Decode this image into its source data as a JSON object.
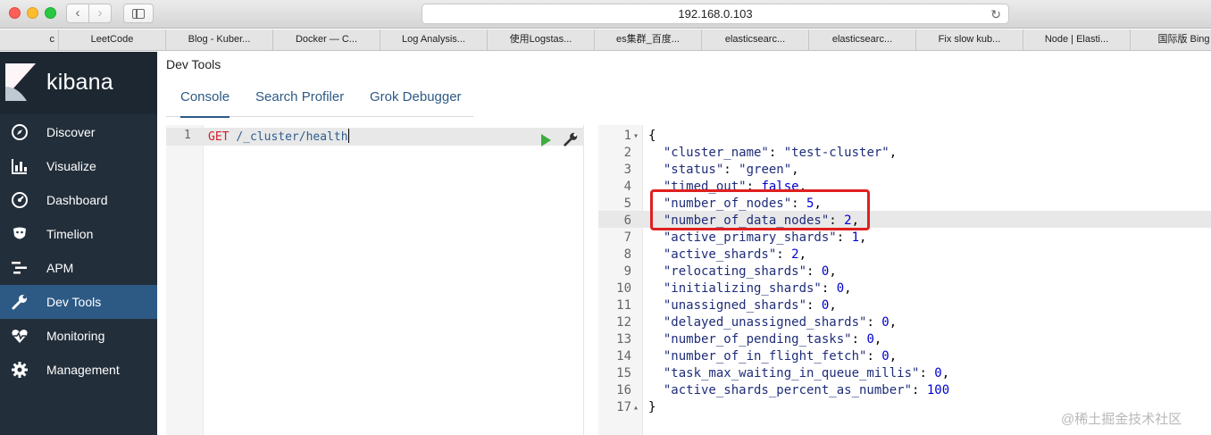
{
  "browser": {
    "url": "192.168.0.103",
    "bookmarks": [
      "c",
      "LeetCode",
      "Blog - Kuber...",
      "Docker — C...",
      "Log Analysis...",
      "使用Logstas...",
      "es集群_百度...",
      "elasticsearc...",
      "elasticsearc...",
      "Fix slow kub...",
      "Node | Elasti...",
      "国际版 Bing"
    ]
  },
  "sidebar": {
    "logo": "kibana",
    "items": [
      {
        "label": "Discover",
        "icon": "compass-icon"
      },
      {
        "label": "Visualize",
        "icon": "bar-chart-icon"
      },
      {
        "label": "Dashboard",
        "icon": "dashboard-icon"
      },
      {
        "label": "Timelion",
        "icon": "timelion-icon"
      },
      {
        "label": "APM",
        "icon": "apm-icon"
      },
      {
        "label": "Dev Tools",
        "icon": "wrench-icon",
        "active": true
      },
      {
        "label": "Monitoring",
        "icon": "heartbeat-icon"
      },
      {
        "label": "Management",
        "icon": "gear-icon"
      }
    ]
  },
  "header": {
    "title": "Dev Tools",
    "tabs": [
      "Console",
      "Search Profiler",
      "Grok Debugger"
    ]
  },
  "request": {
    "line_number": "1",
    "method": "GET",
    "path": "/_cluster/health"
  },
  "response": {
    "lines": [
      {
        "n": "1",
        "fold": true,
        "text": "{"
      },
      {
        "n": "2",
        "key": "\"cluster_name\"",
        "val": "\"test-cluster\"",
        "type": "s",
        "comma": ","
      },
      {
        "n": "3",
        "key": "\"status\"",
        "val": "\"green\"",
        "type": "s",
        "comma": ","
      },
      {
        "n": "4",
        "key": "\"timed_out\"",
        "val": "false",
        "type": "b",
        "comma": ","
      },
      {
        "n": "5",
        "key": "\"number_of_nodes\"",
        "val": "5",
        "type": "n",
        "comma": ","
      },
      {
        "n": "6",
        "key": "\"number_of_data_nodes\"",
        "val": "2",
        "type": "n",
        "comma": ","
      },
      {
        "n": "7",
        "key": "\"active_primary_shards\"",
        "val": "1",
        "type": "n",
        "comma": ","
      },
      {
        "n": "8",
        "key": "\"active_shards\"",
        "val": "2",
        "type": "n",
        "comma": ","
      },
      {
        "n": "9",
        "key": "\"relocating_shards\"",
        "val": "0",
        "type": "n",
        "comma": ","
      },
      {
        "n": "10",
        "key": "\"initializing_shards\"",
        "val": "0",
        "type": "n",
        "comma": ","
      },
      {
        "n": "11",
        "key": "\"unassigned_shards\"",
        "val": "0",
        "type": "n",
        "comma": ","
      },
      {
        "n": "12",
        "key": "\"delayed_unassigned_shards\"",
        "val": "0",
        "type": "n",
        "comma": ","
      },
      {
        "n": "13",
        "key": "\"number_of_pending_tasks\"",
        "val": "0",
        "type": "n",
        "comma": ","
      },
      {
        "n": "14",
        "key": "\"number_of_in_flight_fetch\"",
        "val": "0",
        "type": "n",
        "comma": ","
      },
      {
        "n": "15",
        "key": "\"task_max_waiting_in_queue_millis\"",
        "val": "0",
        "type": "n",
        "comma": ","
      },
      {
        "n": "16",
        "key": "\"active_shards_percent_as_number\"",
        "val": "100",
        "type": "n",
        "comma": ""
      },
      {
        "n": "17",
        "fold": true,
        "text": "}"
      }
    ]
  },
  "watermark": "@稀土掘金技术社区",
  "colors": {
    "sidebar_bg": "#222e3a",
    "active_nav": "#2d5a85",
    "highlight": "#e0201f"
  }
}
